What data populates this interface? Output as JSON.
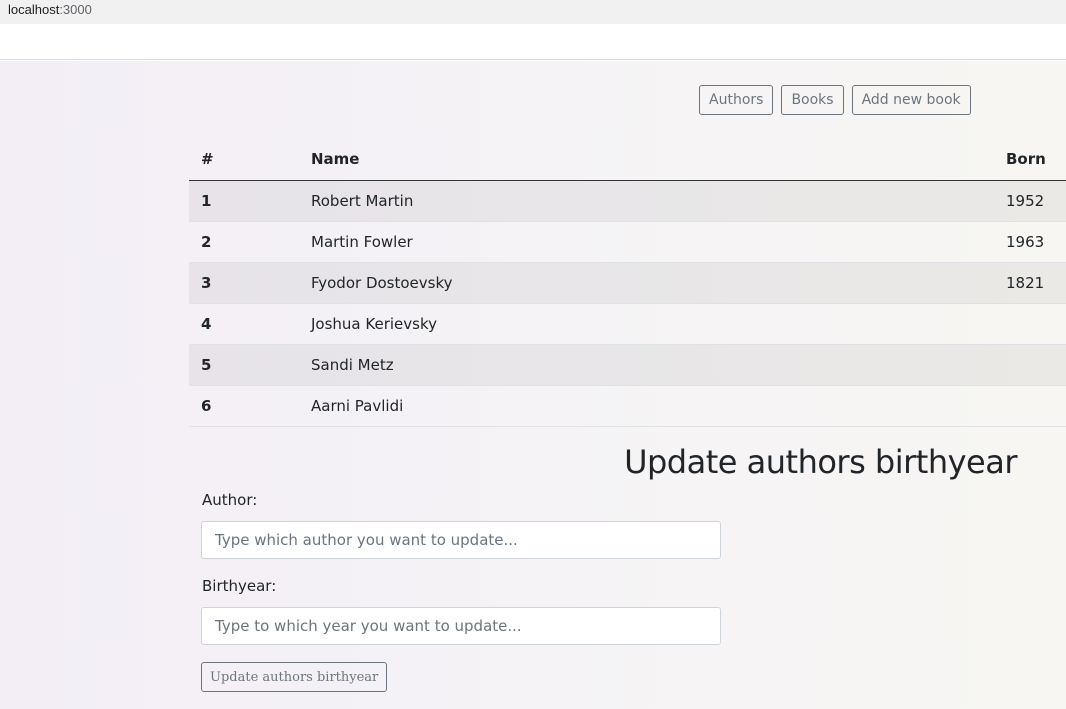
{
  "browser": {
    "host": "localhost",
    "port": ":3000"
  },
  "nav": {
    "authors_label": "Authors",
    "books_label": "Books",
    "add_book_label": "Add new book"
  },
  "table": {
    "headers": {
      "num": "#",
      "name": "Name",
      "born": "Born"
    },
    "rows": [
      {
        "num": "1",
        "name": "Robert Martin",
        "born": "1952"
      },
      {
        "num": "2",
        "name": "Martin Fowler",
        "born": "1963"
      },
      {
        "num": "3",
        "name": "Fyodor Dostoevsky",
        "born": "1821"
      },
      {
        "num": "4",
        "name": "Joshua Kerievsky",
        "born": ""
      },
      {
        "num": "5",
        "name": "Sandi Metz",
        "born": ""
      },
      {
        "num": "6",
        "name": "Aarni Pavlidi",
        "born": ""
      }
    ]
  },
  "form": {
    "title": "Update authors birthyear",
    "author_label": "Author:",
    "author_placeholder": "Type which author you want to update...",
    "author_value": "",
    "birthyear_label": "Birthyear:",
    "birthyear_placeholder": "Type to which year you want to update...",
    "birthyear_value": "",
    "submit_label": "Update authors birthyear"
  }
}
